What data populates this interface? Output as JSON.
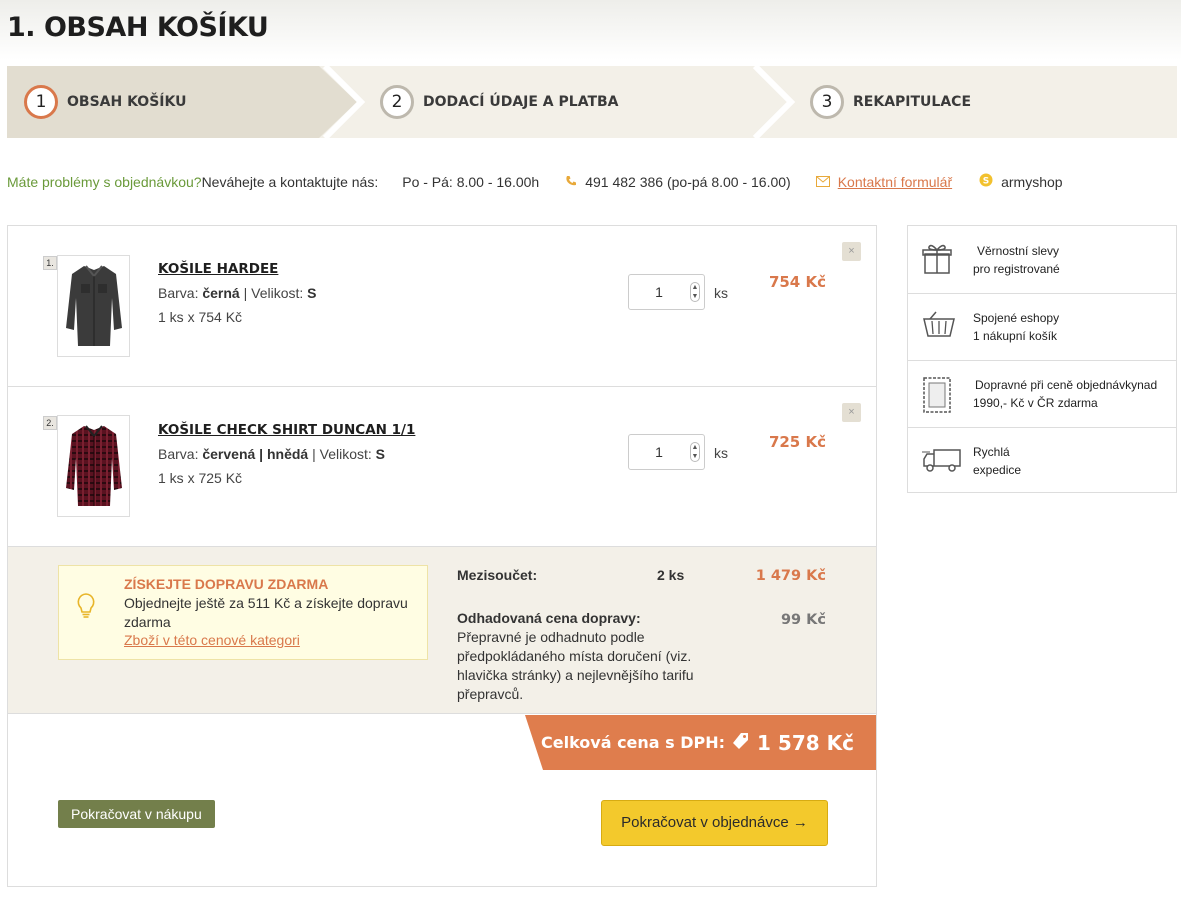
{
  "page": {
    "title": "1. OBSAH KOŠÍKU"
  },
  "steps": [
    {
      "num": "1",
      "label": "OBSAH KOŠÍKU"
    },
    {
      "num": "2",
      "label": "DODACÍ ÚDAJE A PLATBA"
    },
    {
      "num": "3",
      "label": "REKAPITULACE"
    }
  ],
  "contact": {
    "question": "Máte problémy s objednávkou?",
    "prompt": " Neváhejte a kontaktujte nás:",
    "hours": "Po - Pá: 8.00 - 16.00h",
    "phone": "491 482 386 (po-pá 8.00 - 16.00)",
    "form_link": "Kontaktní formulář",
    "skype": "armyshop"
  },
  "items": [
    {
      "index": "1.",
      "name": "KOŠILE HARDEE",
      "color_label": "Barva:",
      "color": "černá",
      "size_label": "Velikost:",
      "size": "S",
      "unit_line": "1 ks x 754 Kč",
      "qty": "1",
      "qty_unit": "ks",
      "price": "754 Kč"
    },
    {
      "index": "2.",
      "name": "KOŠILE CHECK SHIRT DUNCAN 1/1",
      "color_label": "Barva:",
      "color": "červená | hnědá",
      "size_label": "Velikost:",
      "size": "S",
      "unit_line": "1 ks x 725 Kč",
      "qty": "1",
      "qty_unit": "ks",
      "price": "725 Kč"
    }
  ],
  "free_shipping": {
    "title": "ZÍSKEJTE DOPRAVU ZDARMA",
    "text": "Objednejte ještě za 511 Kč a získejte dopravu zdarma",
    "link": "Zboží v této cenové kategori"
  },
  "summary": {
    "subtotal_label": "Mezisoučet:",
    "subtotal_count": "2 ks",
    "subtotal_price": "1 479 Kč",
    "shipping_label": "Odhadovaná cena dopravy:",
    "shipping_text": "Přepravné je odhadnuto podle předpokládaného místa doručení (viz. hlavička stránky) a nejlevnějšího tarifu přepravců.",
    "shipping_price": "99 Kč"
  },
  "total": {
    "label": "Celková cena s DPH:",
    "amount": "1 578 Kč"
  },
  "buttons": {
    "back": "Pokračovat v nákupu",
    "next": "Pokračovat v objednávce →"
  },
  "benefits": [
    {
      "line1": "Věrnostní slevy",
      "line2": "pro registrované",
      "icon": "gift-icon"
    },
    {
      "line1": "Spojené eshopy",
      "line2": "1 nákupní košík",
      "icon": "basket-icon"
    },
    {
      "line1": "Dopravné při ceně objednávkynad",
      "line2": "1990,- Kč v ČR zdarma",
      "icon": "stamp-icon"
    },
    {
      "line1": "Rychlá",
      "line2": "expedice",
      "icon": "truck-icon"
    }
  ],
  "colors": {
    "accent": "#d9784b",
    "green": "#737f4b",
    "cta": "#f3c92c",
    "band": "#f3f0e8"
  }
}
